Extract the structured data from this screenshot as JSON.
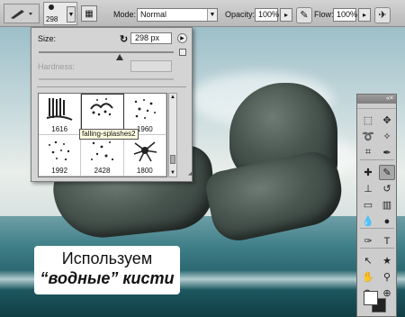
{
  "options_bar": {
    "brush_size": "298",
    "mode_label": "Mode:",
    "mode_value": "Normal",
    "opacity_label": "Opacity:",
    "opacity_value": "100%",
    "flow_label": "Flow:",
    "flow_value": "100%"
  },
  "brush_panel": {
    "size_label": "Size:",
    "size_value": "298 px",
    "size_fraction": 0.6,
    "hardness_label": "Hardness:",
    "presets": [
      {
        "caption": "1616",
        "shape": "waterfall"
      },
      {
        "caption": "",
        "shape": "splash"
      },
      {
        "caption": "1960",
        "shape": "drops"
      },
      {
        "caption": "1992",
        "shape": "spray"
      },
      {
        "caption": "2428",
        "shape": "spray2"
      },
      {
        "caption": "1800",
        "shape": "burst"
      }
    ],
    "tooltip": "falling-splashes2"
  },
  "tools": {
    "items": [
      "marquee-tool-icon",
      "move-tool-icon",
      "lasso-tool-icon",
      "magic-wand-icon",
      "crop-tool-icon",
      "eyedropper-icon",
      "healing-brush-icon",
      "brush-tool-icon",
      "clone-stamp-icon",
      "history-brush-icon",
      "eraser-icon",
      "gradient-icon",
      "blur-icon",
      "dodge-icon",
      "pen-tool-icon",
      "type-tool-icon",
      "path-select-icon",
      "shape-tool-icon",
      "hand-tool-icon",
      "zoom-tool-icon",
      "3d-rotate-icon",
      "3d-orbit-icon"
    ],
    "fg_color": "#ffffff",
    "bg_color": "#222222"
  },
  "caption": {
    "line1": "Используем",
    "line2": "“водные” кисти"
  }
}
